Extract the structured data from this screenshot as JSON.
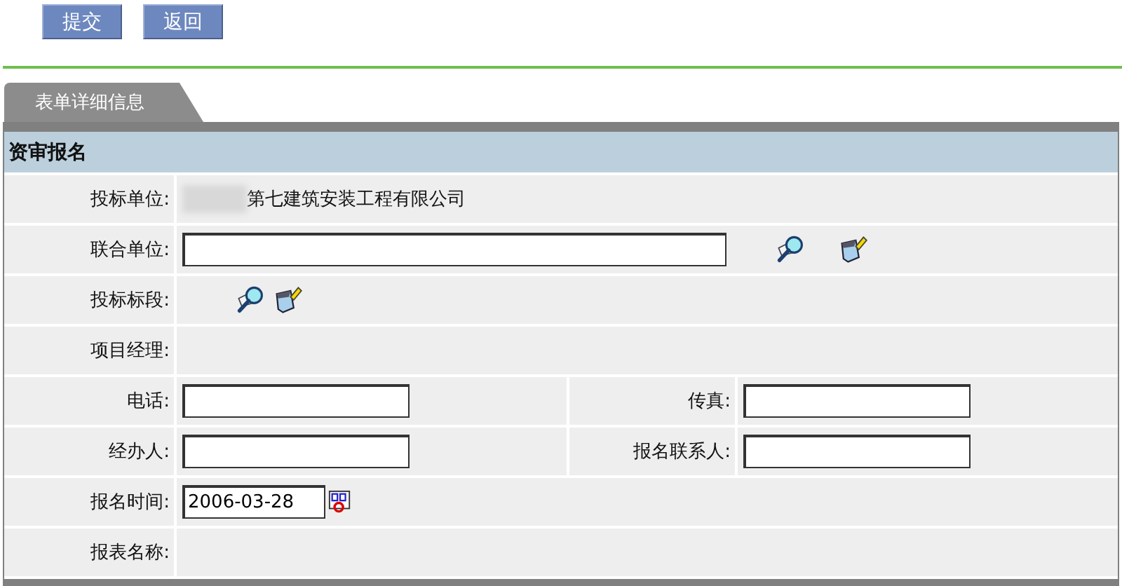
{
  "toolbar": {
    "buttons": [
      "提交",
      "返回"
    ]
  },
  "tabs": [
    {
      "label": "表单详细信息",
      "selected": true
    }
  ],
  "section": {
    "title": "资审报名",
    "rows": [
      {
        "kind": "text",
        "label": "投标单位:",
        "value": "第七建筑安装工程有限公司",
        "redacted": true
      },
      {
        "kind": "lookup",
        "label": "联合单位:"
      },
      {
        "kind": "icons",
        "label": "投标标段:"
      },
      {
        "kind": "empty",
        "label": "项目经理:"
      },
      {
        "kind": "pair",
        "cells": [
          {
            "label": "电话:"
          },
          {
            "label": "传真:"
          }
        ]
      },
      {
        "kind": "pair",
        "cells": [
          {
            "label": "经办人:"
          },
          {
            "label": "报名联系人:"
          }
        ]
      },
      {
        "kind": "date",
        "label": "报名时间:",
        "value": "2006-03-28"
      },
      {
        "kind": "empty",
        "label": "报表名称:"
      }
    ]
  }
}
